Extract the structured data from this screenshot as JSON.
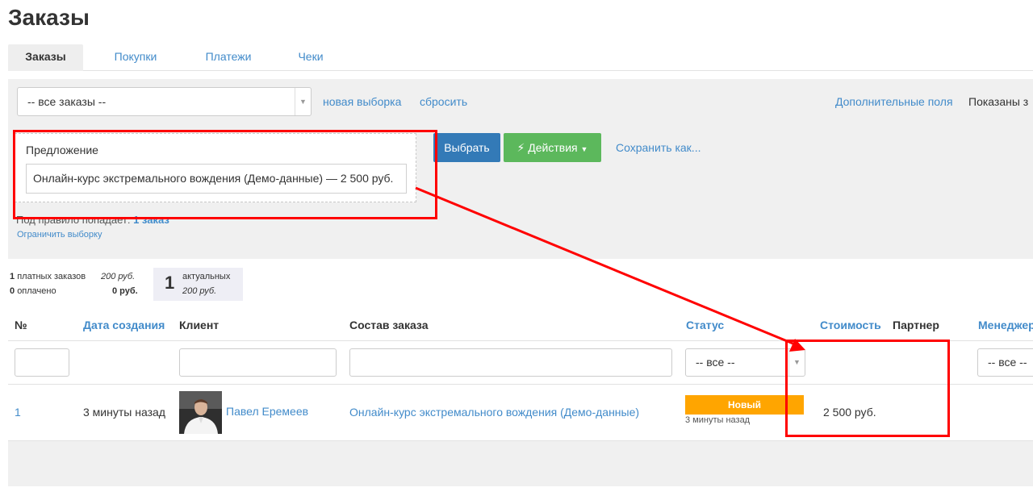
{
  "page": {
    "title": "Заказы"
  },
  "tabs": [
    {
      "label": "Заказы",
      "active": true
    },
    {
      "label": "Покупки"
    },
    {
      "label": "Платежи"
    },
    {
      "label": "Чеки"
    }
  ],
  "filter": {
    "segment_select": "-- все заказы --",
    "new_selection_link": "новая выборка",
    "reset_link": "сбросить",
    "extra_fields_link": "Дополнительные поля",
    "shown_text": "Показаны з",
    "offer_label": "Предложение",
    "offer_value": "Онлайн-курс экстремального вождения (Демо-данные) — 2 500 руб.",
    "select_button": "Выбрать",
    "actions_button": "Действия",
    "save_as_link": "Сохранить как...",
    "rule_text": "Под правило попадает:",
    "rule_count": "1 заказ",
    "limit_link": "Ограничить выборку"
  },
  "stats": {
    "paid_count": "1",
    "paid_label": "платных заказов",
    "paid_sum": "200 руб.",
    "paid_done_count": "0",
    "paid_done_label": "оплачено",
    "paid_done_sum": "0 руб.",
    "actual_count": "1",
    "actual_label": "актуальных",
    "actual_sum": "200 руб."
  },
  "table": {
    "headers": {
      "num": "№",
      "created": "Дата создания",
      "client": "Клиент",
      "composition": "Состав заказа",
      "status": "Статус",
      "cost": "Стоимость",
      "partner": "Партнер",
      "manager": "Менеджер"
    },
    "filters": {
      "status_select": "-- все --",
      "manager_select": "-- все --"
    },
    "rows": [
      {
        "num": "1",
        "created": "3 минуты назад",
        "client": "Павел Еремеев",
        "composition": "Онлайн-курс экстремального вождения (Демо-данные)",
        "status": "Новый",
        "status_time": "3 минуты назад",
        "cost": "2 500 руб."
      }
    ]
  },
  "colors": {
    "link": "#428bca",
    "primary_button": "#337ab7",
    "success_button": "#5cb85c",
    "status_new": "#ffa500",
    "annotation": "#ff0000"
  }
}
